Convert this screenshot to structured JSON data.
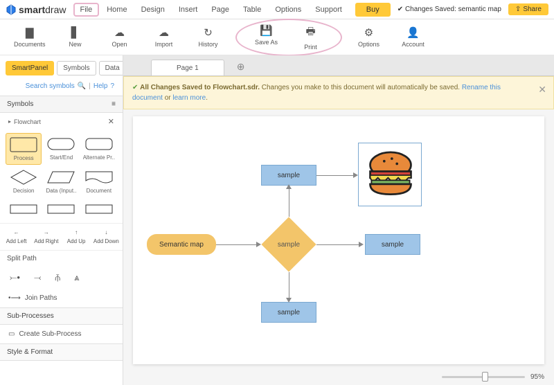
{
  "brand": {
    "name": "smartdraw"
  },
  "menu": {
    "file": "File",
    "home": "Home",
    "design": "Design",
    "insert": "Insert",
    "page": "Page",
    "table": "Table",
    "options": "Options",
    "support": "Support",
    "buy": "Buy"
  },
  "saved_status": "Changes Saved: semantic map",
  "share": "Share",
  "ribbon": {
    "documents": "Documents",
    "new": "New",
    "open": "Open",
    "import": "Import",
    "history": "History",
    "saveas": "Save As",
    "print": "Print",
    "options": "Options",
    "account": "Account"
  },
  "panel": {
    "tabs": {
      "smartpanel": "SmartPanel",
      "symbols": "Symbols",
      "data": "Data"
    },
    "search": "Search symbols",
    "help": "Help",
    "symbols_hdr": "Symbols",
    "flowchart": "Flowchart",
    "shapes": {
      "process": "Process",
      "startend": "Start/End",
      "altproc": "Alternate Pr..",
      "decision": "Decision",
      "datainput": "Data (Input..",
      "document": "Document"
    },
    "actions": {
      "addleft": "Add Left",
      "addright": "Add Right",
      "addup": "Add Up",
      "adddown": "Add Down"
    },
    "split": "Split Path",
    "join": "Join Paths",
    "subproc_hdr": "Sub-Processes",
    "create_sub": "Create Sub-Process",
    "style": "Style & Format"
  },
  "page": {
    "tab1": "Page 1"
  },
  "notice": {
    "bold": "All Changes Saved to Flowchart.sdr.",
    "text": " Changes you make to this document will automatically be saved. ",
    "rename": "Rename this document",
    "or": " or ",
    "learn": "learn more",
    "dot": "."
  },
  "flow": {
    "semmap": "Semantic map",
    "sample": "sample"
  },
  "zoom": "95%"
}
